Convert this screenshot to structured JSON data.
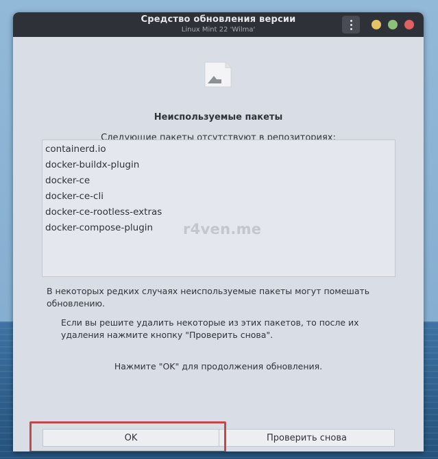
{
  "window": {
    "title": "Средство обновления версии",
    "subtitle": "Linux Mint 22 'Wilma'"
  },
  "icons": {
    "menu": "kebab-menu-icon",
    "document": "document-icon",
    "minimize": "minimize-icon",
    "maximize": "maximize-icon",
    "close": "close-icon"
  },
  "colors": {
    "titlebar": "#2e3138",
    "window_bg": "#d9dde6",
    "minimize": "#e5c365",
    "maximize": "#8dc07a",
    "close": "#e06063",
    "highlight_border": "#c4464b"
  },
  "dialog": {
    "heading": "Неиспользуемые пакеты",
    "subheading": "Следующие пакеты отсутствуют в репозиториях:",
    "packages": [
      "containerd.io",
      "docker-buildx-plugin",
      "docker-ce",
      "docker-ce-cli",
      "docker-ce-rootless-extras",
      "docker-compose-plugin"
    ],
    "watermark": "r4ven.me",
    "para1": "В некоторых редких случаях неиспользуемые пакеты могут помешать обновлению.",
    "para2": "Если вы решите удалить некоторые из этих пакетов, то после их удаления нажмите кнопку \"Проверить снова\".",
    "para3": "Нажмите \"OK\" для продолжения обновления."
  },
  "buttons": {
    "ok": "OK",
    "recheck": "Проверить снова"
  }
}
